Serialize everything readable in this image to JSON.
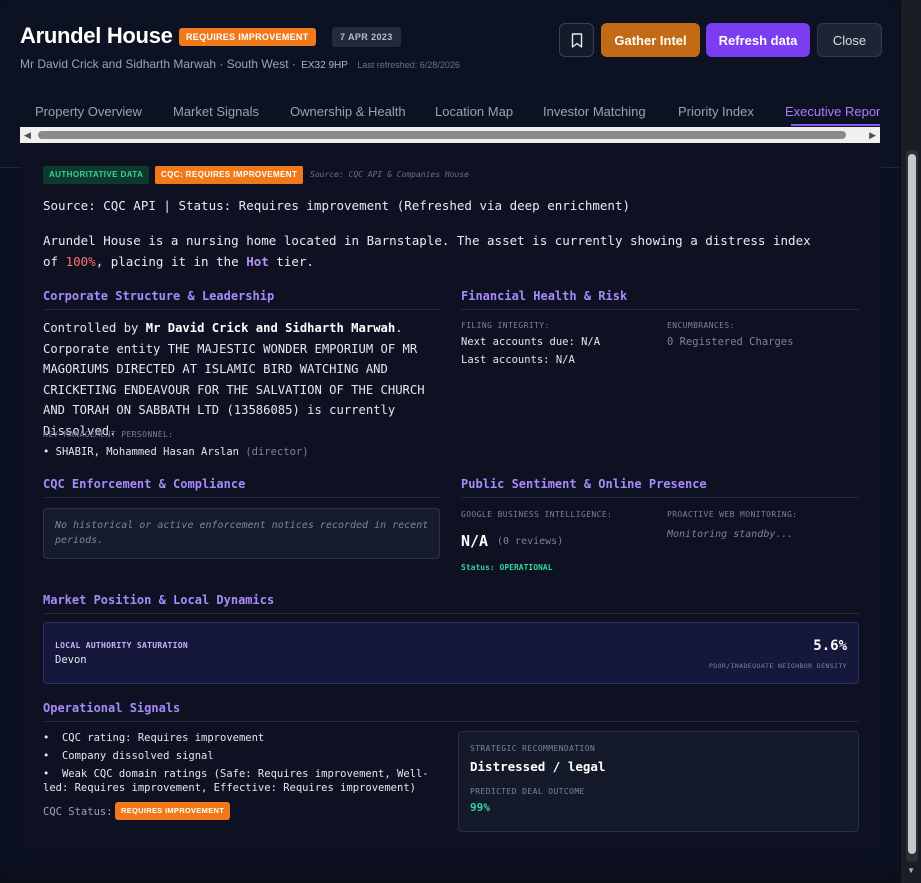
{
  "header": {
    "title": "Arundel House",
    "status_badge": "REQUIRES IMPROVEMENT",
    "date_badge": "7 APR 2023",
    "owners_region": "Mr David Crick and Sidharth Marwah · South West ·",
    "postcode": "EX32 9HP",
    "refreshed": "Last refreshed: 6/28/2026",
    "buttons": {
      "gather": "Gather Intel",
      "refresh": "Refresh data",
      "close": "Close"
    },
    "bookmark_icon": "bookmark-icon"
  },
  "tabs": [
    {
      "label": "Property Overview"
    },
    {
      "label": "Market Signals"
    },
    {
      "label": "Ownership & Health"
    },
    {
      "label": "Location Map"
    },
    {
      "label": "Investor Matching"
    },
    {
      "label": "Priority Index"
    },
    {
      "label": "Executive Repor"
    }
  ],
  "content": {
    "tag_authoritative": "AUTHORITATIVE DATA",
    "tag_cqc": "CQC: REQUIRES IMPROVEMENT",
    "source_note": "Source: CQC API & Companies House",
    "source_line": "Source: CQC API | Status: Requires improvement (Refreshed via deep enrichment)",
    "summary": {
      "prefix": "Arundel House is a nursing home located in Barnstaple. The asset is currently showing a distress index of ",
      "distress_index": "100%",
      "middle": ", placing it in the ",
      "tier": "Hot",
      "suffix": " tier."
    },
    "corporate": {
      "title": "Corporate Structure & Leadership",
      "controlled_prefix": "Controlled by ",
      "controllers": "Mr David Crick and Sidharth Marwah",
      "entity_prefix": ". Corporate entity ",
      "entity_name": "THE MAJESTIC WONDER EMPORIUM OF MR MAGORIUMS DIRECTED AT ISLAMIC BIRD WATCHING AND CRICKETING ENDEAVOUR FOR THE SALVATION OF THE CHURCH AND TORAH ON SABBATH LTD",
      "entity_suffix": " (13586085) is currently Dissolved.",
      "personnel_label": "KEY MANAGEMENT PERSONNEL:",
      "personnel_name": "SHABIR, Mohammed Hasan Arslan",
      "personnel_role": "(director)"
    },
    "financial": {
      "title": "Financial Health & Risk",
      "filing_label": "FILING INTEGRITY:",
      "next_accounts": "Next accounts due: N/A",
      "last_accounts": "Last accounts: N/A",
      "encumbrances_label": "ENCUMBRANCES:",
      "encumbrances_value": "0 Registered Charges"
    },
    "enforcement": {
      "title": "CQC Enforcement & Compliance",
      "notice": "No historical or active enforcement notices recorded in recent periods."
    },
    "sentiment": {
      "title": "Public Sentiment & Online Presence",
      "google_label": "GOOGLE BUSINESS INTELLIGENCE:",
      "rating": "N/A",
      "reviews": "(0 reviews)",
      "status": "Status: OPERATIONAL",
      "monitoring_label": "PROACTIVE WEB MONITORING:",
      "monitoring_value": "Monitoring standby..."
    },
    "market": {
      "title": "Market Position & Local Dynamics",
      "label": "LOCAL AUTHORITY SATURATION",
      "region": "Devon",
      "percent": "5.6%",
      "sub": "POOR/INADEQUATE NEIGHBOR DENSITY"
    },
    "operational": {
      "title": "Operational Signals",
      "items": [
        "CQC rating: Requires improvement",
        "Company dissolved signal",
        "Weak CQC domain ratings (Safe: Requires improvement, Well-led: Requires improvement, Effective: Requires improvement)"
      ],
      "cqc_status_label": "CQC Status:",
      "cqc_status_badge": "REQUIRES IMPROVEMENT",
      "strategic_label": "STRATEGIC RECOMMENDATION",
      "strategic_value": "Distressed / legal",
      "outcome_label": "PREDICTED DEAL OUTCOME",
      "outcome_value": "99%"
    }
  },
  "colors": {
    "accent_orange": "#f07a1a",
    "accent_violet": "#7c3df0",
    "gather_orange": "#c26a14",
    "positive_green": "#34d399",
    "danger_red": "#f87171"
  }
}
